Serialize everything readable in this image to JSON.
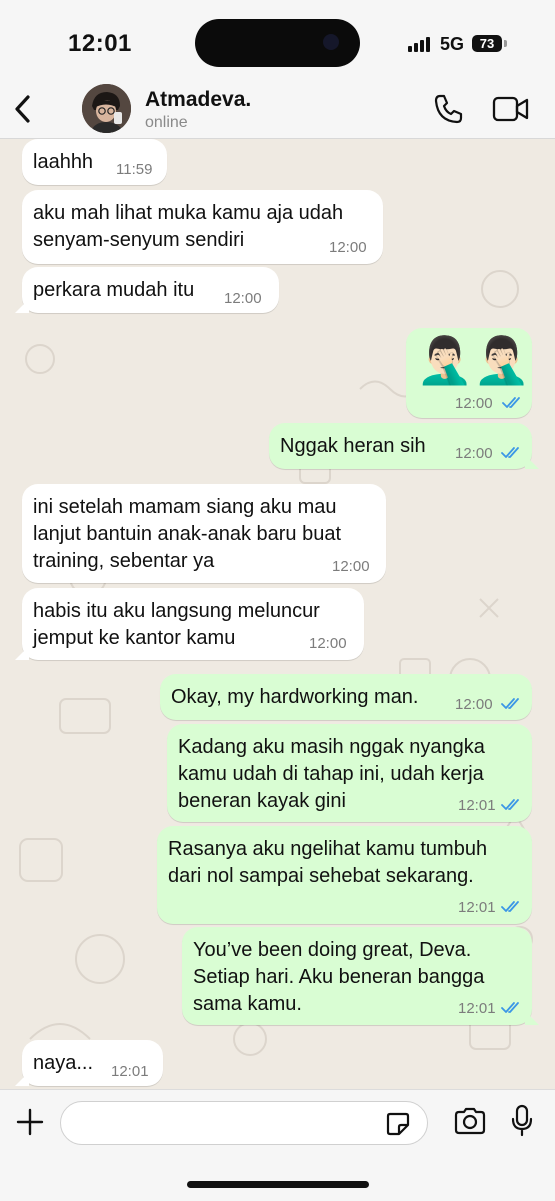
{
  "status_bar": {
    "time": "12:01",
    "network": "5G",
    "battery": "73"
  },
  "header": {
    "contact_name": "Atmadeva.",
    "contact_status": "online"
  },
  "messages": [
    {
      "direction": "in",
      "text": "laahhh",
      "time": "11:59"
    },
    {
      "direction": "in",
      "text": "aku mah lihat muka kamu aja udah\nsenyam-senyum sendiri",
      "time": "12:00"
    },
    {
      "direction": "in",
      "text": "perkara mudah itu",
      "time": "12:00"
    },
    {
      "direction": "out",
      "emoji": "🤦🏻‍♂️🤦🏻‍♂️",
      "time": "12:00",
      "read": true
    },
    {
      "direction": "out",
      "text": "Nggak heran sih",
      "time": "12:00",
      "read": true
    },
    {
      "direction": "in",
      "text": "ini setelah mamam siang aku mau\nlanjut bantuin anak-anak baru buat\ntraining, sebentar ya",
      "time": "12:00"
    },
    {
      "direction": "in",
      "text": "habis itu aku langsung meluncur\njemput ke kantor kamu",
      "time": "12:00"
    },
    {
      "direction": "out",
      "text": "Okay, my hardworking man.",
      "time": "12:00",
      "read": true
    },
    {
      "direction": "out",
      "text": "Kadang aku masih nggak nyangka\nkamu udah di tahap ini, udah kerja\nbeneran kayak gini",
      "time": "12:01",
      "read": true
    },
    {
      "direction": "out",
      "text": "Rasanya aku ngelihat kamu tumbuh\ndari nol sampai sehebat sekarang.",
      "time": "12:01",
      "read": true
    },
    {
      "direction": "out",
      "text": "You’ve been doing great, Deva.\nSetiap hari. Aku beneran bangga\nsama kamu.",
      "time": "12:01",
      "read": true
    },
    {
      "direction": "in",
      "text": "naya...",
      "time": "12:01"
    }
  ],
  "input": {
    "message_value": ""
  },
  "colors": {
    "incoming": "#ffffff",
    "outgoing": "#d9fdd3",
    "read_tick": "#3b96e6",
    "wallpaper": "#efeae2"
  }
}
